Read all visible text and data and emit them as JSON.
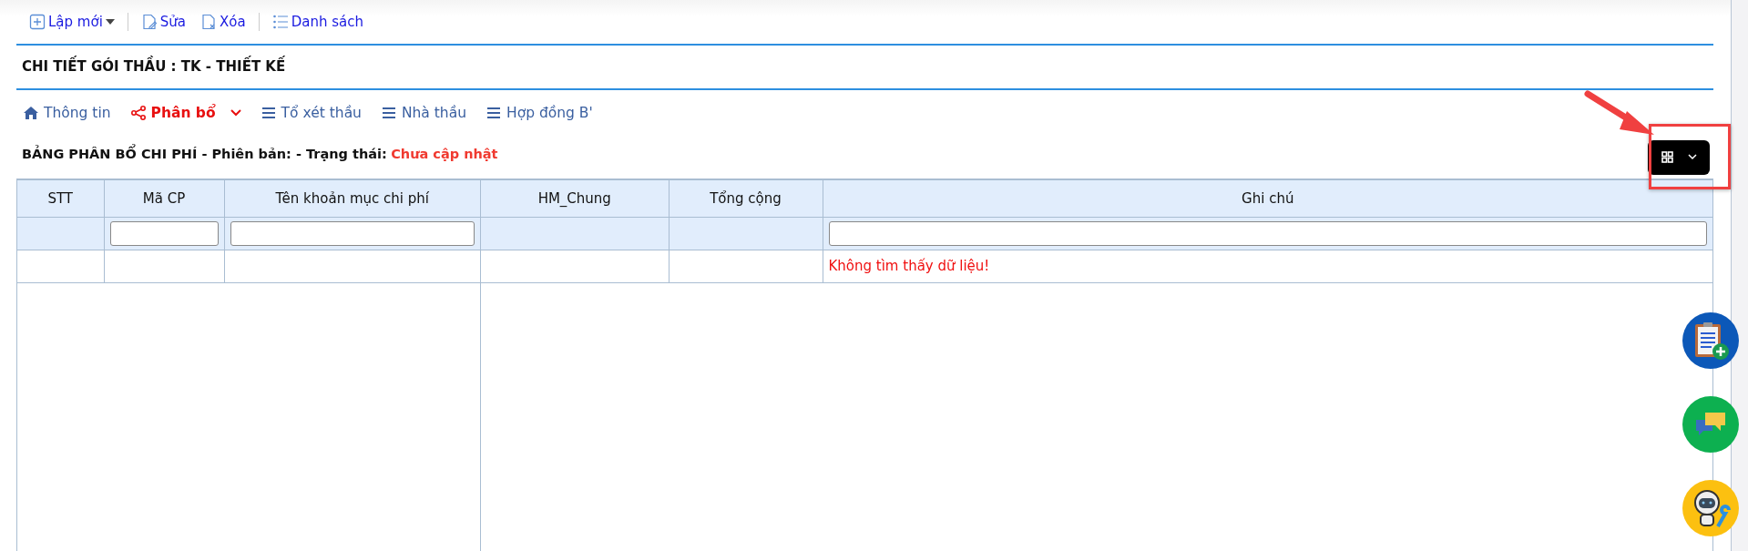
{
  "toolbar": [
    {
      "kind": "add",
      "label": "Lập mới",
      "dropdown": true
    },
    {
      "kind": "edit",
      "label": "Sửa",
      "dropdown": false
    },
    {
      "kind": "delete",
      "label": "Xóa",
      "dropdown": false
    },
    {
      "kind": "list",
      "label": "Danh sách",
      "dropdown": false
    }
  ],
  "page_title": "CHI TIẾT GÓI THẦU : TK - THIẾT KẾ",
  "tabs": [
    {
      "kind": "home",
      "label": "Thông tin",
      "selected": false,
      "dropdown": false
    },
    {
      "kind": "share",
      "label": "Phân bổ",
      "selected": true,
      "dropdown": true
    },
    {
      "kind": "bars",
      "label": "Tổ xét thầu",
      "selected": false,
      "dropdown": false
    },
    {
      "kind": "bars",
      "label": "Nhà thầu",
      "selected": false,
      "dropdown": false
    },
    {
      "kind": "bars",
      "label": "Hợp đồng B'",
      "selected": false,
      "dropdown": false
    }
  ],
  "section": {
    "title": "BẢNG PHÂN BỔ CHI PHÍ - Phiên bản: - Trạng thái:",
    "status": "Chưa cập nhật"
  },
  "table": {
    "left_columns": [
      {
        "label": "STT",
        "filter": false
      },
      {
        "label": "Mã CP",
        "filter": true
      },
      {
        "label": "Tên khoản mục chi phí",
        "filter": true
      }
    ],
    "right_columns": [
      {
        "label": "HM_Chung",
        "filter": false
      },
      {
        "label": "Tổng cộng",
        "filter": false
      },
      {
        "label": "Ghi chú",
        "filter": true
      }
    ],
    "empty_message": "Không tìm thấy dữ liệu!"
  }
}
